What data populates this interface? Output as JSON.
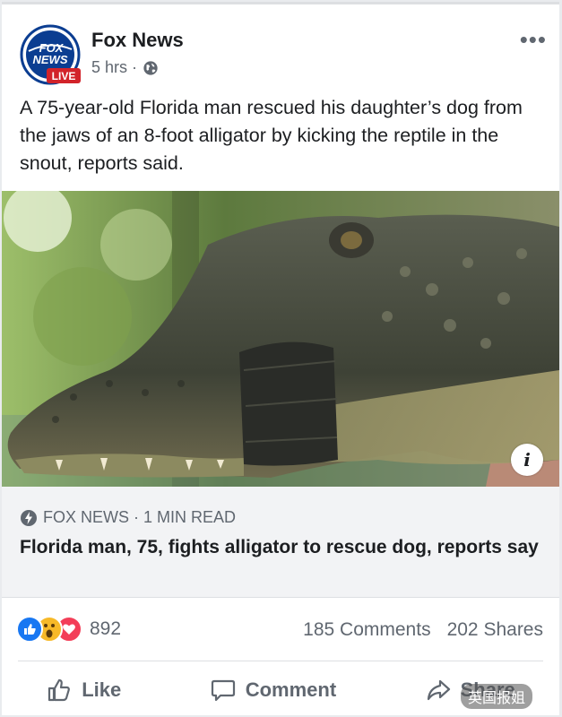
{
  "post": {
    "author": "Fox News",
    "time": "5 hrs ·",
    "more_label": "•••",
    "logo": {
      "line1": "FOX",
      "line2": "NEWS",
      "badge": "LIVE"
    },
    "text": "A 75-year-old Florida man rescued his daughter’s dog from the jaws of an 8-foot alligator by kicking the reptile in the snout, reports said.",
    "photo": {
      "subject": "alligator-with-taped-snout",
      "info_label": "i"
    }
  },
  "link": {
    "source": "FOX NEWS · 1 MIN READ",
    "headline": "Florida man, 75, fights alligator to rescue dog, reports say"
  },
  "stats": {
    "reactions_count": "892",
    "comments": "185 Comments",
    "shares": "202 Shares"
  },
  "actions": {
    "like": "Like",
    "comment": "Comment",
    "share": "Share"
  },
  "watermark": "英国报姐",
  "colors": {
    "accent": "#1877f2",
    "fox_red": "#d2232a",
    "fox_blue": "#0b3d91"
  }
}
